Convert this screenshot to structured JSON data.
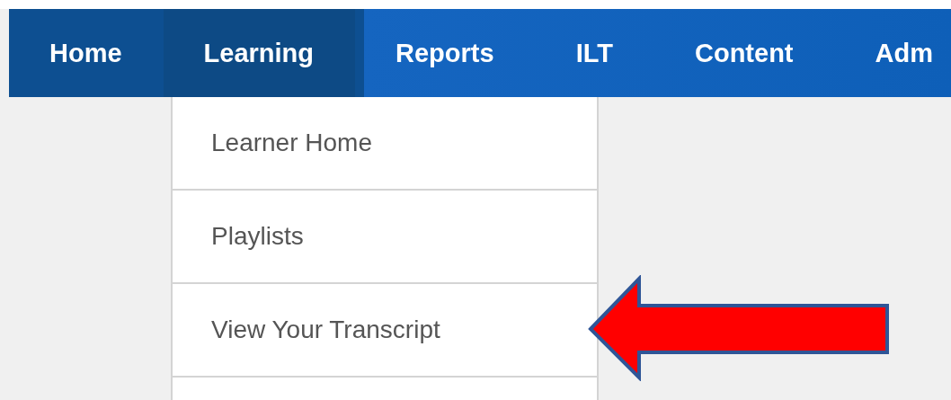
{
  "nav": {
    "items": [
      {
        "label": "Home",
        "selected": false
      },
      {
        "label": "Learning",
        "selected": true
      },
      {
        "label": "Reports",
        "selected": false
      },
      {
        "label": "ILT",
        "selected": false
      },
      {
        "label": "Content",
        "selected": false
      },
      {
        "label": "Adm",
        "selected": false
      }
    ]
  },
  "dropdown": {
    "items": [
      {
        "label": "Learner Home"
      },
      {
        "label": "Playlists"
      },
      {
        "label": "View Your Transcript"
      }
    ]
  }
}
